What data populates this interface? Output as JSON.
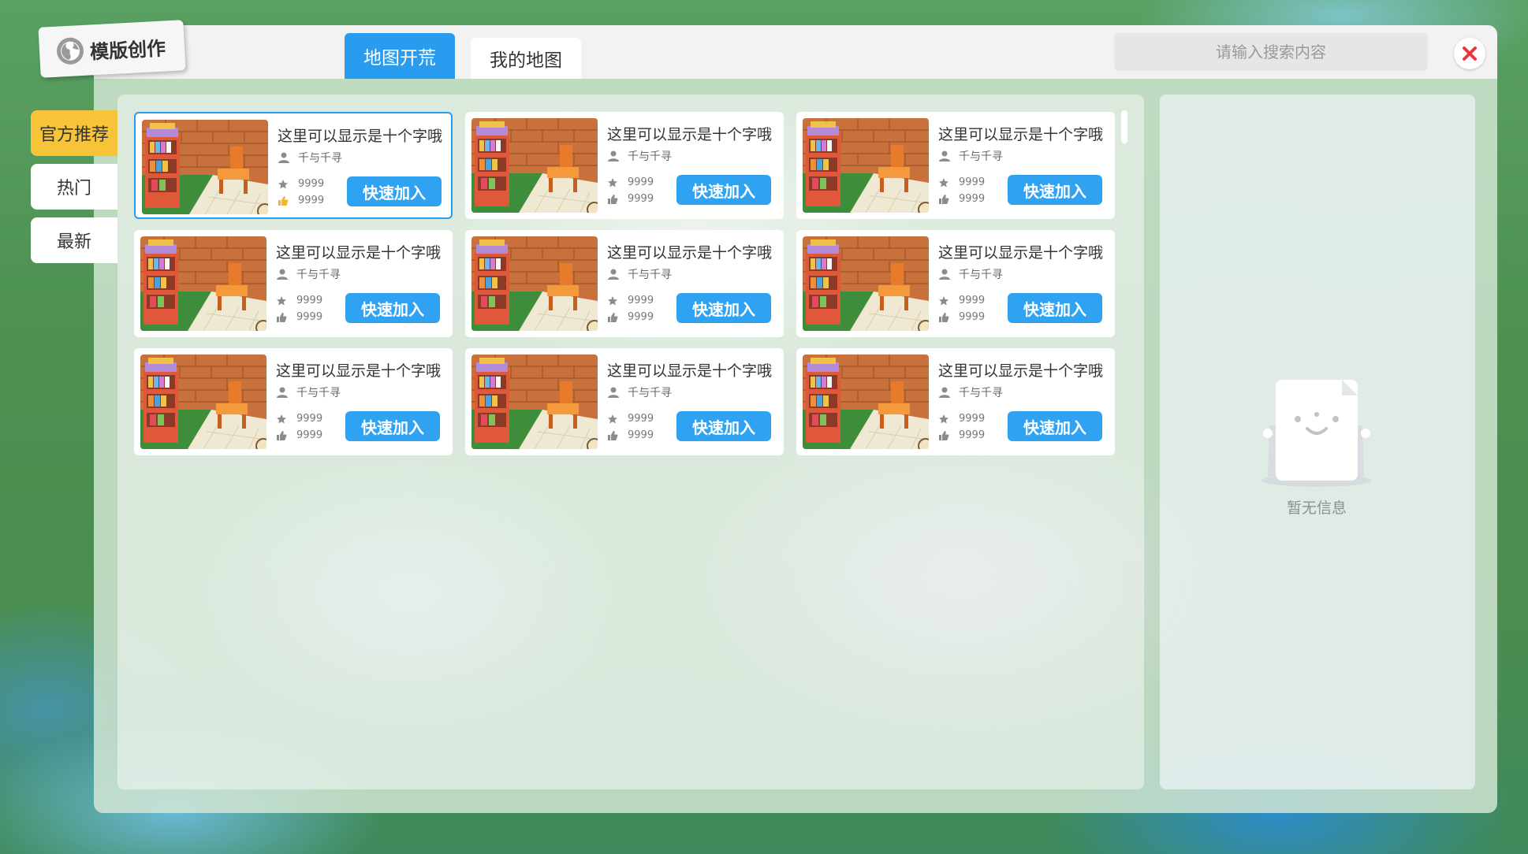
{
  "header": {
    "app_title": "模版创作",
    "tabs": [
      {
        "label": "地图开荒",
        "active": true
      },
      {
        "label": "我的地图",
        "active": false
      }
    ],
    "search_placeholder": "请输入搜索内容"
  },
  "sidebar": {
    "items": [
      {
        "label": "官方推荐",
        "active": true
      },
      {
        "label": "热门",
        "active": false
      },
      {
        "label": "最新",
        "active": false
      }
    ]
  },
  "cards": [
    {
      "title": "这里可以显示是十个字哦",
      "author": "千与千寻",
      "stars": "9999",
      "likes": "9999",
      "button": "快速加入",
      "selected": true
    },
    {
      "title": "这里可以显示是十个字哦",
      "author": "千与千寻",
      "stars": "9999",
      "likes": "9999",
      "button": "快速加入",
      "selected": false
    },
    {
      "title": "这里可以显示是十个字哦",
      "author": "千与千寻",
      "stars": "9999",
      "likes": "9999",
      "button": "快速加入",
      "selected": false
    },
    {
      "title": "这里可以显示是十个字哦",
      "author": "千与千寻",
      "stars": "9999",
      "likes": "9999",
      "button": "快速加入",
      "selected": false
    },
    {
      "title": "这里可以显示是十个字哦",
      "author": "千与千寻",
      "stars": "9999",
      "likes": "9999",
      "button": "快速加入",
      "selected": false
    },
    {
      "title": "这里可以显示是十个字哦",
      "author": "千与千寻",
      "stars": "9999",
      "likes": "9999",
      "button": "快速加入",
      "selected": false
    },
    {
      "title": "这里可以显示是十个字哦",
      "author": "千与千寻",
      "stars": "9999",
      "likes": "9999",
      "button": "快速加入",
      "selected": false
    },
    {
      "title": "这里可以显示是十个字哦",
      "author": "千与千寻",
      "stars": "9999",
      "likes": "9999",
      "button": "快速加入",
      "selected": false
    },
    {
      "title": "这里可以显示是十个字哦",
      "author": "千与千寻",
      "stars": "9999",
      "likes": "9999",
      "button": "快速加入",
      "selected": false
    }
  ],
  "detail": {
    "empty_text": "暂无信息"
  },
  "colors": {
    "accent": "#2a9cf0",
    "sidebar_active": "#f7c338",
    "close": "#e8383d"
  },
  "icons": {
    "logo": "globe-icon",
    "close": "close-icon",
    "author": "user-icon",
    "stars": "star-icon",
    "likes": "thumbs-up-icon",
    "empty": "empty-document-icon"
  }
}
